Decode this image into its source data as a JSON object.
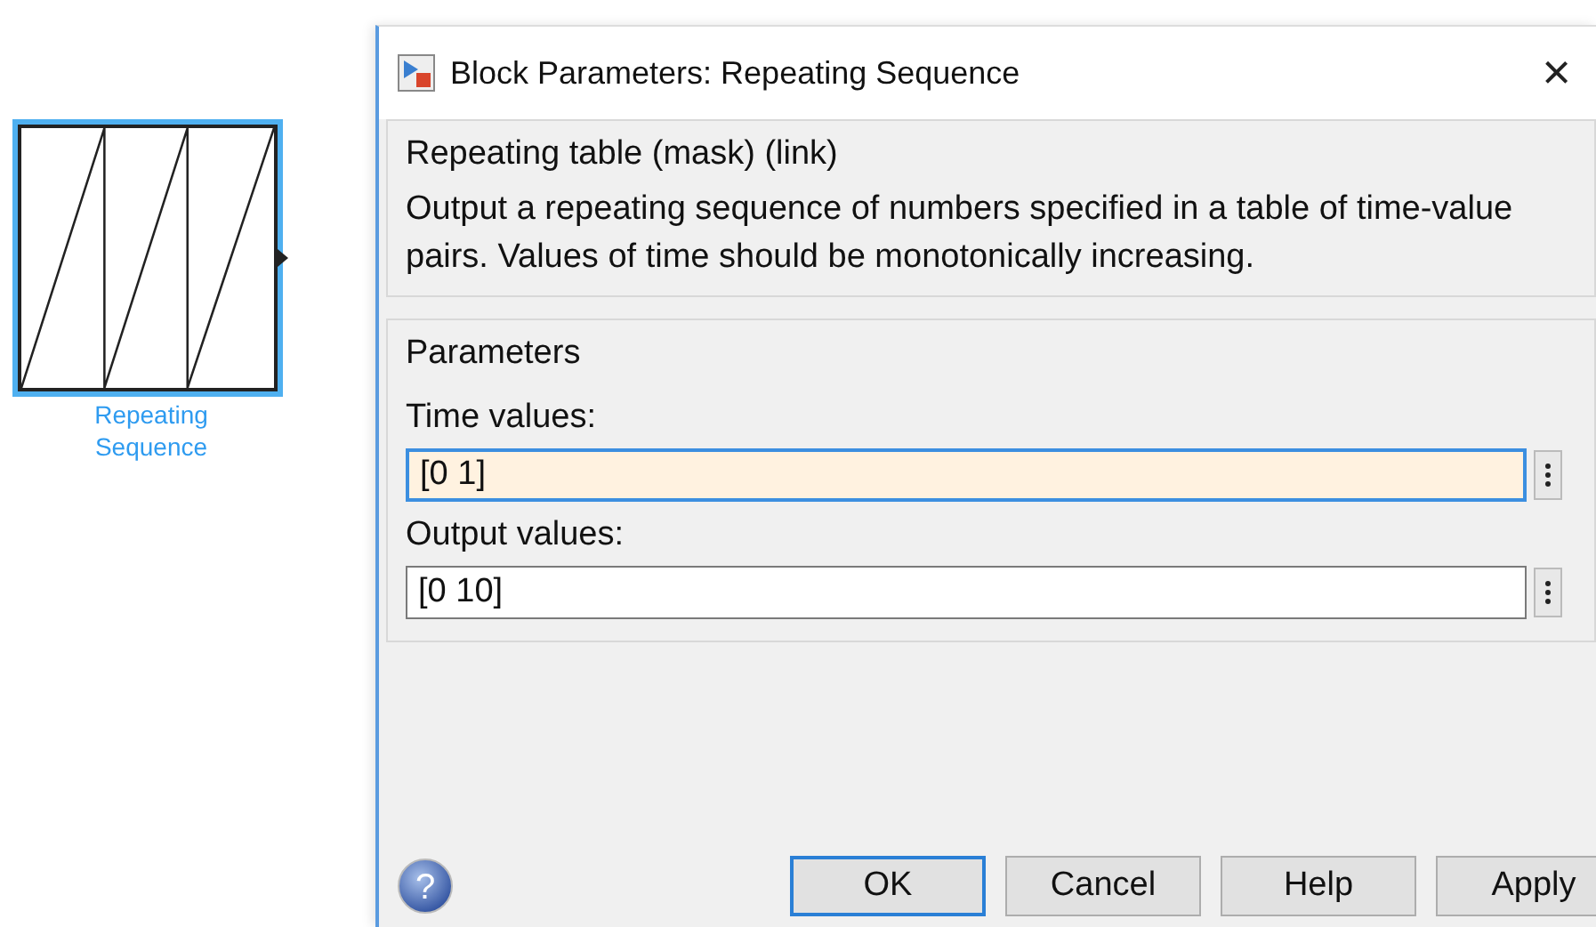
{
  "block": {
    "label_lines": [
      "Repeating",
      "Sequence"
    ],
    "selected": true
  },
  "dialog": {
    "title": "Block Parameters: Repeating Sequence",
    "close": "×",
    "description": {
      "title": "Repeating table (mask) (link)",
      "text": "Output a repeating sequence of numbers specified in a table of time-value pairs. Values of time should be monotonically increasing."
    },
    "parameters": {
      "title": "Parameters",
      "fields": [
        {
          "label": "Time values:",
          "value": "[0 1]",
          "focused": true
        },
        {
          "label": "Output values:",
          "value": "[0 10]",
          "focused": false
        }
      ]
    },
    "help_icon": "?",
    "buttons": [
      {
        "label": "OK",
        "default": true
      },
      {
        "label": "Cancel",
        "default": false
      },
      {
        "label": "Help",
        "default": false
      },
      {
        "label": "Apply",
        "default": false
      }
    ]
  }
}
